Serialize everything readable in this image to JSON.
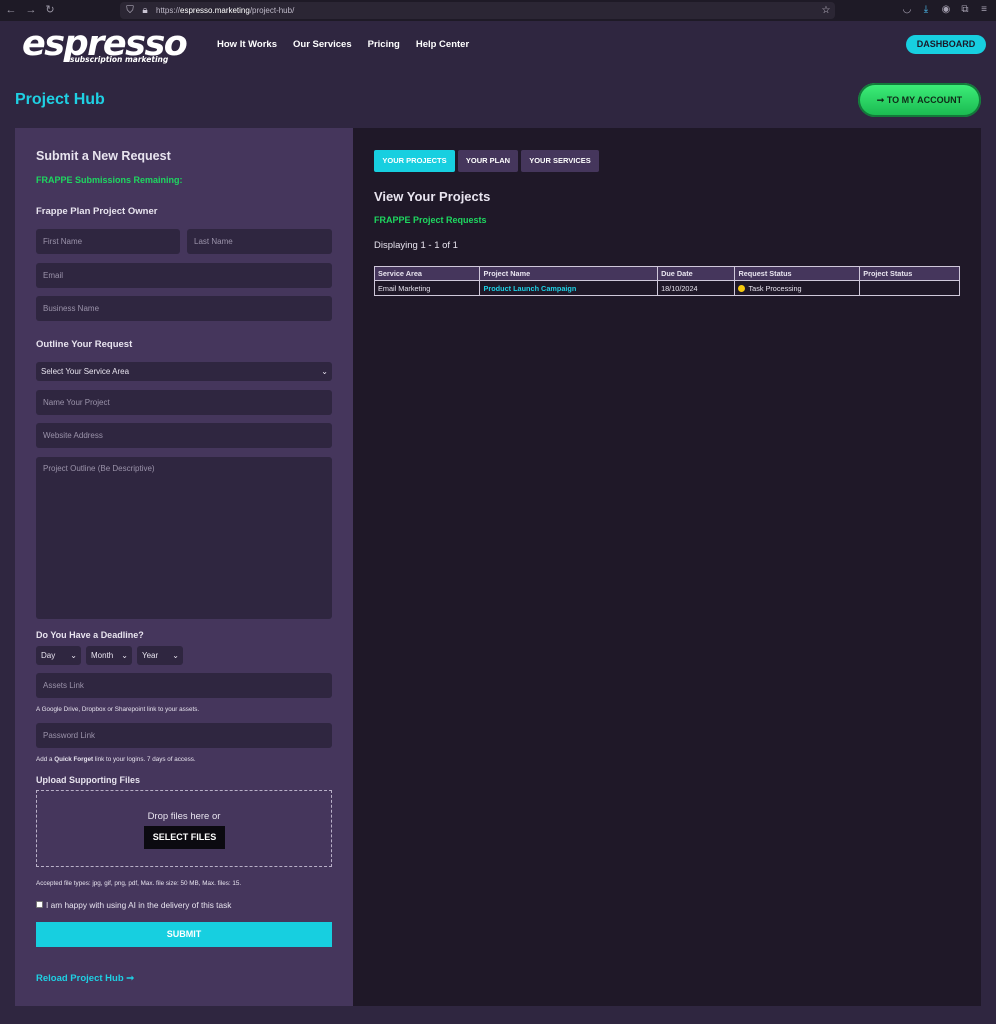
{
  "browser": {
    "url_prefix": "https://",
    "url_domain": "espresso.marketing",
    "url_path": "/project-hub/"
  },
  "header": {
    "logo_main": "espresso",
    "logo_sub": "subscription marketing",
    "nav": [
      "How It Works",
      "Our Services",
      "Pricing",
      "Help Center"
    ],
    "dashboard_label": "DASHBOARD"
  },
  "page": {
    "title": "Project Hub",
    "account_label": "TO MY ACCOUNT"
  },
  "form": {
    "title": "Submit a New Request",
    "remaining": "FRAPPE Submissions Remaining:",
    "owner_heading": "Frappe Plan Project Owner",
    "first_name_ph": "First Name",
    "last_name_ph": "Last Name",
    "email_ph": "Email",
    "business_ph": "Business Name",
    "outline_heading": "Outline Your Request",
    "service_area": "Select Your Service Area",
    "project_name_ph": "Name Your Project",
    "website_ph": "Website Address",
    "outline_ph": "Project Outline (Be Descriptive)",
    "deadline_heading": "Do You Have a Deadline?",
    "day": "Day",
    "month": "Month",
    "year": "Year",
    "assets_ph": "Assets Link",
    "assets_help": "A Google Drive, Dropbox or Sharepoint link to your assets.",
    "password_ph": "Password Link",
    "password_help_pre": "Add a ",
    "password_help_bold": "Quick Forget",
    "password_help_post": " link to your logins. 7 days of access.",
    "upload_heading": "Upload Supporting Files",
    "drop_text": "Drop files here or",
    "select_files": "SELECT FILES",
    "accepted": "Accepted file types: jpg, gif, png, pdf, Max. file size: 50 MB, Max. files: 15.",
    "ai_consent": "I am happy with using AI in the delivery of this task",
    "submit": "SUBMIT",
    "reload": "Reload Project Hub ➞"
  },
  "projects": {
    "tabs": [
      "YOUR PROJECTS",
      "YOUR PLAN",
      "YOUR SERVICES"
    ],
    "title": "View Your Projects",
    "subtitle": "FRAPPE Project Requests",
    "count": "Displaying 1 - 1 of 1",
    "columns": [
      "Service Area",
      "Project Name",
      "Due Date",
      "Request Status",
      "Project Status"
    ],
    "rows": [
      {
        "service_area": "Email Marketing",
        "project_name": "Product Launch Campaign",
        "due_date": "18/10/2024",
        "request_status": "Task Processing",
        "project_status": ""
      }
    ]
  },
  "colors": {
    "accent": "#17cfe0",
    "green": "#1ed760",
    "panel": "#45365c",
    "background": "#2f2640"
  },
  "icons": [
    "back-icon",
    "forward-icon",
    "reload-icon",
    "shield-icon",
    "lock-icon",
    "star-icon",
    "pocket-icon",
    "download-icon",
    "account-icon",
    "extensions-icon",
    "menu-icon",
    "arrow-right-icon",
    "status-dot-icon"
  ]
}
